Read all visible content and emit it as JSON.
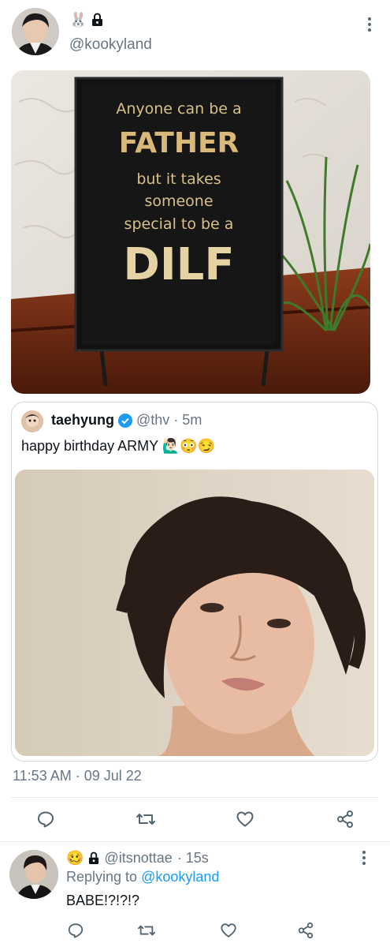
{
  "main_tweet": {
    "handle": "@kookyland",
    "name_emoji": "🐰",
    "image_sign": {
      "line1": "Anyone can be a",
      "line2": "FATHER",
      "line3": "but it takes",
      "line4": "someone",
      "line5": "special to be a",
      "line6": "DILF"
    },
    "timestamp": "11:53 AM · 09 Jul 22"
  },
  "quoted_tweet": {
    "display_name": "taehyung",
    "handle": "@thv",
    "time": "· 5m",
    "text": "happy birthday ARMY 🙋🏻‍♂️😳😏"
  },
  "reply": {
    "handle": "@itsnottae",
    "time": "· 15s",
    "replying_prefix": "Replying to",
    "replying_handle": "@kookyland",
    "text": "BABE!?!?!?",
    "emoji": "🥴"
  },
  "colors": {
    "accent": "#1d9bf0",
    "verified": "#1d9bf0",
    "muted": "#687684"
  }
}
